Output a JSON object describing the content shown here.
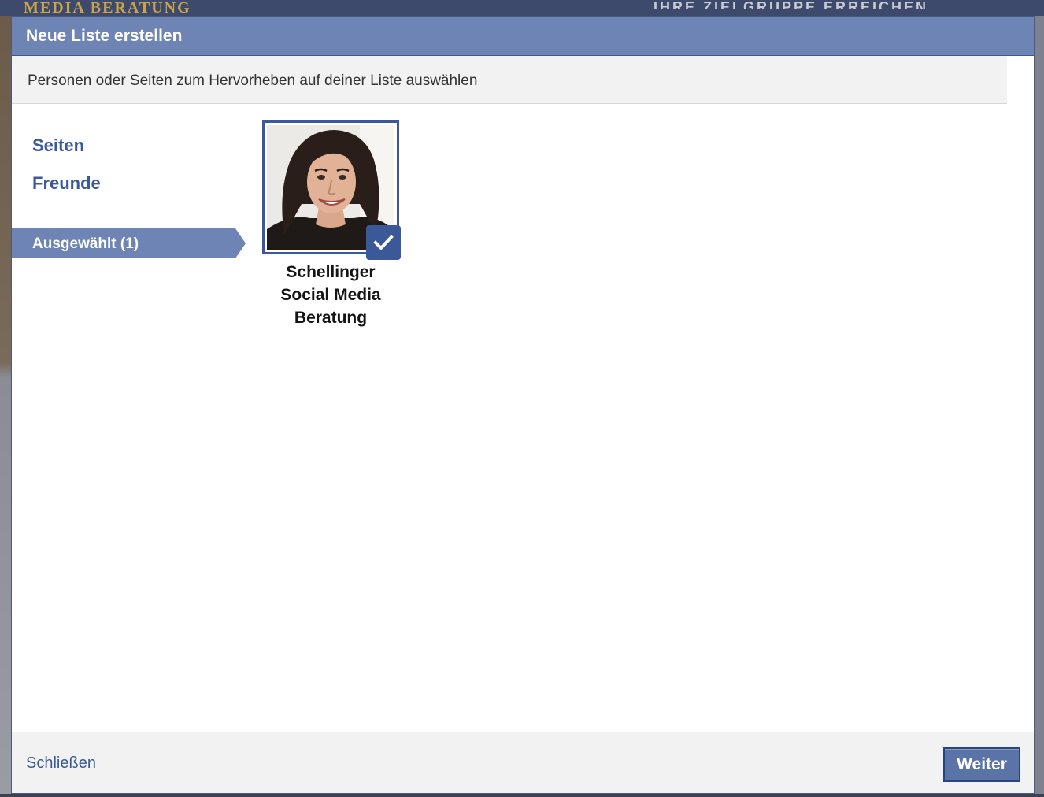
{
  "background_page": {
    "brand_partial": "MEDIA BERATUNG",
    "slogan_partial": "IHRE ZIELGRUPPE ERREICHEN"
  },
  "dialog": {
    "title": "Neue Liste erstellen",
    "instruction": "Personen oder Seiten zum Hervorheben auf deiner Liste auswählen"
  },
  "sidebar": {
    "items": [
      {
        "label": "Seiten"
      },
      {
        "label": "Freunde"
      }
    ],
    "selected_label": "Ausgewählt (1)"
  },
  "selected_items": [
    {
      "name_lines": [
        "Schellinger",
        "Social Media",
        "Beratung"
      ],
      "selected": true,
      "icon": "checkmark-icon"
    }
  ],
  "footer": {
    "close_label": "Schließen",
    "next_label": "Weiter"
  },
  "colors": {
    "header_bg": "#6d84b4",
    "link": "#3b5998",
    "button_bg": "#5b74a8"
  }
}
